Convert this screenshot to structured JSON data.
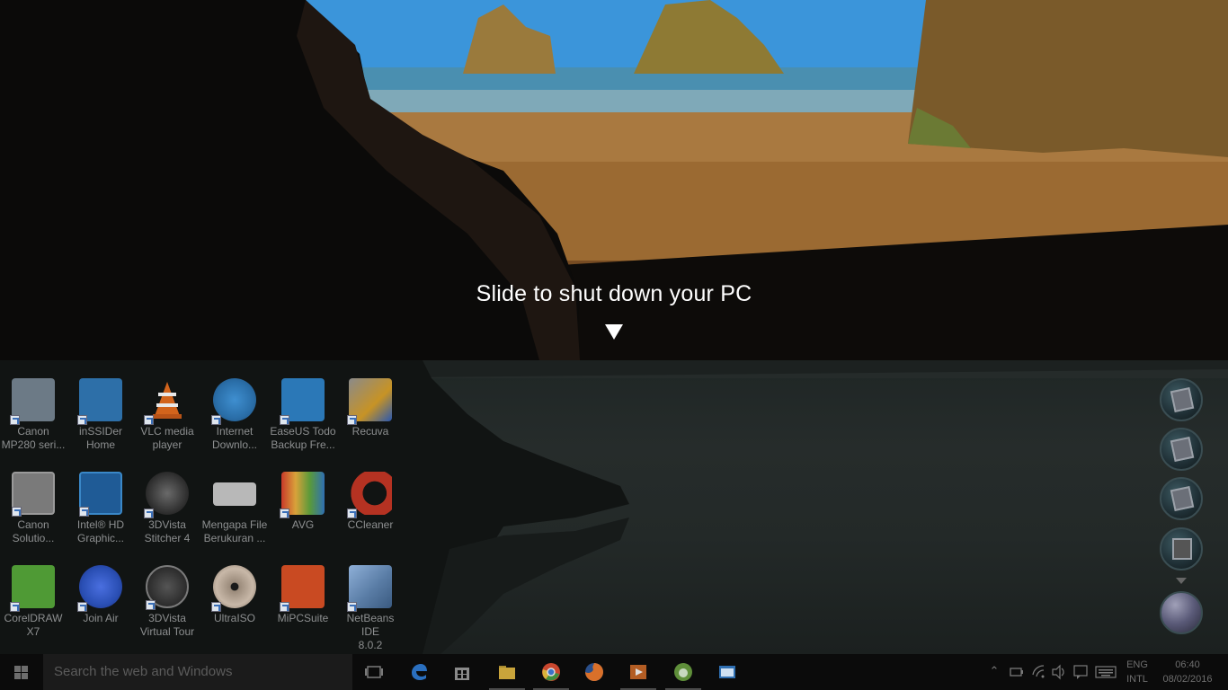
{
  "shutdown_overlay": {
    "message": "Slide to shut down your PC",
    "arrow": "down-arrow"
  },
  "desktop": {
    "icons": [
      {
        "label": "Canon\nMP280 seri...",
        "icon": "canon-printer-help-icon",
        "color": "#6c7a86"
      },
      {
        "label": "inSSIDer\nHome",
        "icon": "inssider-icon",
        "color": "#2d6fa8"
      },
      {
        "label": "VLC media\nplayer",
        "icon": "vlc-cone-icon",
        "color": "#d2641c"
      },
      {
        "label": "Internet\nDownlo...",
        "icon": "idm-globe-icon",
        "color": "#2f7fc2"
      },
      {
        "label": "EaseUS Todo\nBackup Fre...",
        "icon": "easeus-icon",
        "color": "#2b78b7"
      },
      {
        "label": "Recuva",
        "icon": "recuva-icon",
        "color": "#c79325"
      },
      {
        "label": "Canon\nSolutio...",
        "icon": "canon-solution-icon",
        "color": "#7a7a7a"
      },
      {
        "label": "Intel® HD\nGraphic...",
        "icon": "intel-graphics-icon",
        "color": "#1f5b96"
      },
      {
        "label": "3DVista\nStitcher 4",
        "icon": "camera-icon",
        "color": "#4a4a4a"
      },
      {
        "label": "Mengapa File\nBerukuran ...",
        "icon": "document-icon",
        "color": "#b8b8b8"
      },
      {
        "label": "AVG",
        "icon": "avg-icon",
        "color": "#b83a2a"
      },
      {
        "label": "CCleaner",
        "icon": "ccleaner-icon",
        "color": "#b53222"
      },
      {
        "label": "CorelDRAW\nX7",
        "icon": "coreldraw-icon",
        "color": "#4f9a35"
      },
      {
        "label": "Join Air",
        "icon": "join-air-3g-icon",
        "color": "#2a4fb4"
      },
      {
        "label": "3DVista\nVirtual Tour",
        "icon": "virtual-tour-icon",
        "color": "#3b3b3b"
      },
      {
        "label": "UltraISO",
        "icon": "disc-icon",
        "color": "#9a8a7a"
      },
      {
        "label": "MiPCSuite",
        "icon": "mi-icon",
        "color": "#c94a22"
      },
      {
        "label": "NetBeans IDE\n8.0.2",
        "icon": "netbeans-cube-icon",
        "color": "#5a7da6"
      }
    ],
    "gadgets": [
      "photo-gadget-icon",
      "photo-gadget-icon",
      "photo-gadget-icon",
      "media-center-gadget-icon",
      "orb-gadget-icon"
    ]
  },
  "taskbar": {
    "search_placeholder": "Search the web and Windows",
    "pinned": [
      {
        "name": "task-view",
        "color": "#7a7a7a"
      },
      {
        "name": "edge",
        "color": "#2a6fbf"
      },
      {
        "name": "store",
        "color": "#8a8a8a"
      },
      {
        "name": "file-explorer",
        "color": "#c9a43b"
      },
      {
        "name": "chrome",
        "color": "#c9472f"
      },
      {
        "name": "firefox",
        "color": "#d9702a"
      },
      {
        "name": "media-player",
        "color": "#b35d24"
      },
      {
        "name": "android-studio",
        "color": "#5f8f3a"
      },
      {
        "name": "app-window",
        "color": "#2f6fb2"
      }
    ],
    "tray": {
      "lang_line1": "ENG",
      "lang_line2": "INTL",
      "time": "06:40",
      "date": "08/02/2016"
    }
  }
}
